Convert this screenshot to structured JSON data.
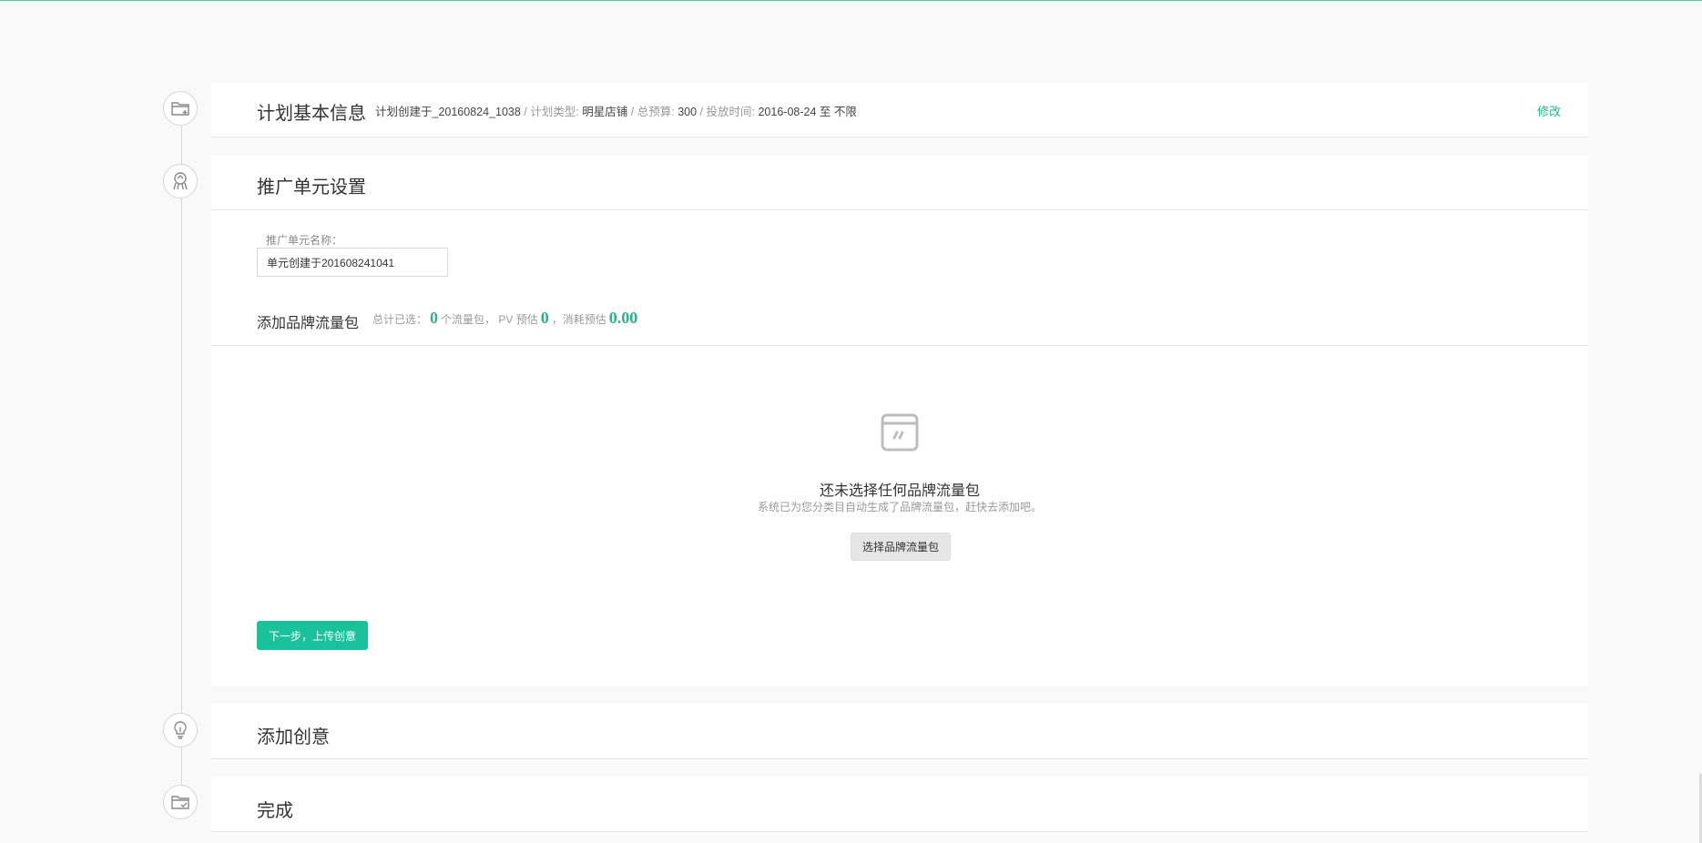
{
  "steps": {
    "plan_info": {
      "title": "计划基本信息",
      "created_label": "计划创建于_20160824_1038",
      "type_label": "计划类型:",
      "type_value": "明星店铺",
      "budget_label": "总预算:",
      "budget_value": "300",
      "time_label": "投放时间:",
      "time_value": "2016-08-24 至 不限",
      "separator": "/",
      "edit_label": "修改"
    },
    "unit_settings": {
      "title": "推广单元设置",
      "name_label": "推广单元名称：",
      "name_value": "单元创建于201608241041",
      "package_title": "添加品牌流量包",
      "summary": {
        "selected_prefix": "总计已选：",
        "selected_count": "0",
        "selected_unit": "个流量包，",
        "pv_label": "PV 预估",
        "pv_value": "0",
        "cost_label": "，消耗预估",
        "cost_value": "0.00"
      },
      "empty_title": "还未选择任何品牌流量包",
      "empty_sub": "系统已为您分类目自动生成了品牌流量包，赶快去添加吧。",
      "choose_button": "选择品牌流量包",
      "next_button": "下一步，上传创意"
    },
    "add_creative": {
      "title": "添加创意"
    },
    "complete": {
      "title": "完成"
    }
  },
  "colors": {
    "accent": "#19c29a",
    "accent_text": "#2bb38a",
    "background": "#f9f9f9"
  },
  "icons": {
    "step1": "folder-add-icon",
    "step2": "unit-settings-icon",
    "step3": "lightbulb-icon",
    "step4": "folder-check-icon",
    "empty": "empty-package-icon"
  }
}
